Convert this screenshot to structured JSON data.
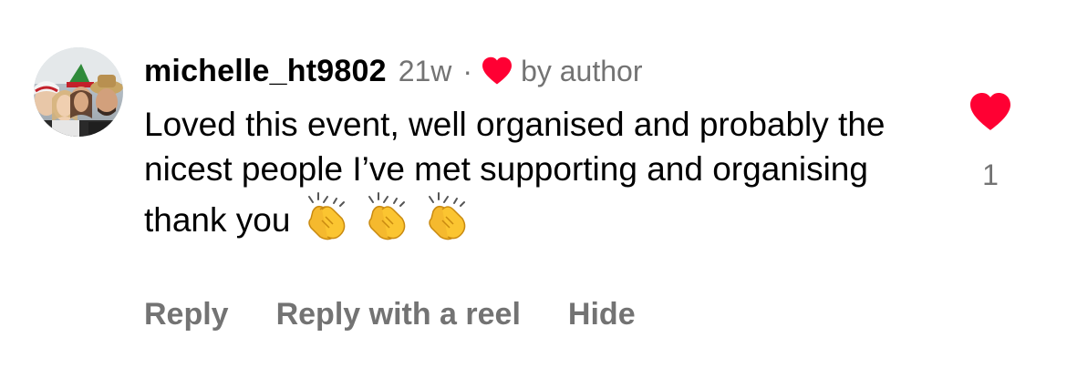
{
  "comment": {
    "username": "michelle_ht9802",
    "time": "21w",
    "separator": "·",
    "liked_by_author_label": "by author",
    "text": "Loved this event, well organised and probably the nicest people I’ve met supporting and organising thank you",
    "emoji_count": 3,
    "emoji_name": "clapping-hands-icon",
    "likes": "1",
    "liked": true
  },
  "actions": {
    "reply_label": "Reply",
    "reply_with_reel_label": "Reply with a reel",
    "hide_label": "Hide"
  },
  "colors": {
    "heart": "#ff0033",
    "secondary_text": "#737373",
    "primary_text": "#000000",
    "clap_yellow": "#fbc531"
  }
}
